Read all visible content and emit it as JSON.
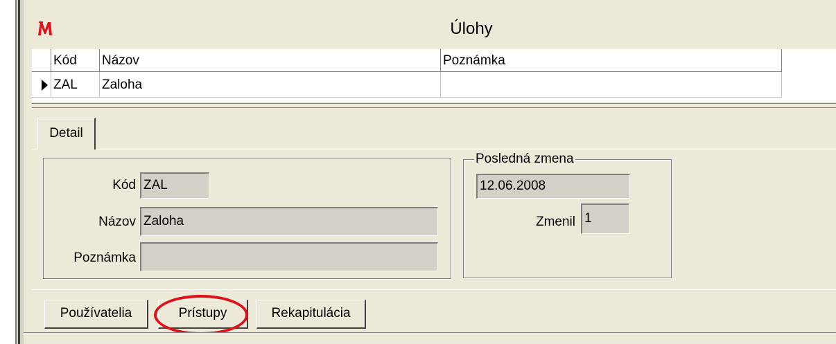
{
  "window": {
    "title": "Úlohy",
    "logo_glyph": "M",
    "logo_icon": "app-logo-icon",
    "accent_color": "#e0101a"
  },
  "grid": {
    "columns": [
      "Kód",
      "Názov",
      "Poznámka"
    ],
    "rows": [
      {
        "kod": "ZAL",
        "nazov": "Zaloha",
        "poznamka": ""
      }
    ],
    "current_row_indicator": "row-pointer-icon"
  },
  "tabs": [
    {
      "label": "Detail",
      "active": true
    }
  ],
  "detail": {
    "kod_label": "Kód",
    "kod_value": "ZAL",
    "nazov_label": "Názov",
    "nazov_value": "Zaloha",
    "poznamka_label": "Poznámka",
    "poznamka_value": ""
  },
  "last_change": {
    "legend": "Posledná zmena",
    "date": "12.06.2008",
    "zmenil_label": "Zmenil",
    "zmenil_value": "1"
  },
  "buttons": {
    "users": "Používatelia",
    "access": "Prístupy",
    "recap": "Rekapitulácia"
  }
}
